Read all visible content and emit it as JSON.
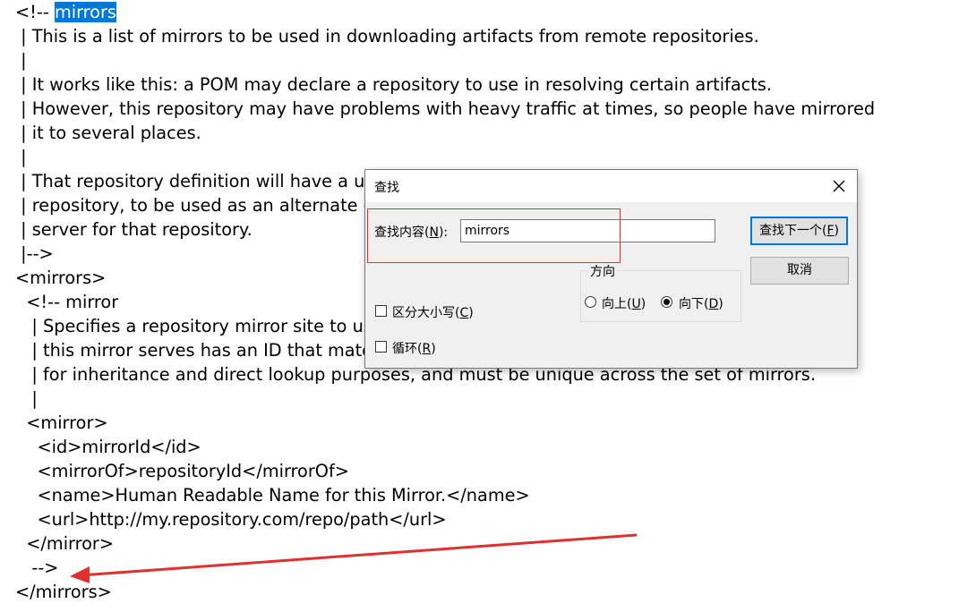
{
  "editor": {
    "lines": [
      {
        "pre": "<!-- ",
        "hl": "mirrors",
        "post": ""
      },
      {
        "pre": " | This is a list of mirrors to be used in downloading artifacts from remote repositories.",
        "hl": "",
        "post": ""
      },
      {
        "pre": " |",
        "hl": "",
        "post": ""
      },
      {
        "pre": " | It works like this: a POM may declare a repository to use in resolving certain artifacts.",
        "hl": "",
        "post": ""
      },
      {
        "pre": " | However, this repository may have problems with heavy traffic at times, so people have mirrored",
        "hl": "",
        "post": ""
      },
      {
        "pre": " | it to several places.",
        "hl": "",
        "post": ""
      },
      {
        "pre": " |",
        "hl": "",
        "post": ""
      },
      {
        "pre": " | That repository definition will have a unique id, so we can create a mirror reference for that",
        "hl": "",
        "post": ""
      },
      {
        "pre": " | repository, to be used as an alternate download site. The mirror site will be the preferred",
        "hl": "",
        "post": ""
      },
      {
        "pre": " | server for that repository.",
        "hl": "",
        "post": ""
      },
      {
        "pre": " |-->",
        "hl": "",
        "post": ""
      },
      {
        "pre": "<mirrors>",
        "hl": "",
        "post": ""
      },
      {
        "pre": "  <!-- mirror",
        "hl": "",
        "post": ""
      },
      {
        "pre": "   | Specifies a repository mirror site to use instead of a given repository. The repository that",
        "hl": "",
        "post": ""
      },
      {
        "pre": "   | this mirror serves has an ID that matches the mirrorOf element of this mirror. IDs are used",
        "hl": "",
        "post": ""
      },
      {
        "pre": "   | for inheritance and direct lookup purposes, and must be unique across the set of mirrors.",
        "hl": "",
        "post": ""
      },
      {
        "pre": "   |",
        "hl": "",
        "post": ""
      },
      {
        "pre": "  <mirror>",
        "hl": "",
        "post": ""
      },
      {
        "pre": "    <id>mirrorId</id>",
        "hl": "",
        "post": ""
      },
      {
        "pre": "    <mirrorOf>repositoryId</mirrorOf>",
        "hl": "",
        "post": ""
      },
      {
        "pre": "    <name>Human Readable Name for this Mirror.</name>",
        "hl": "",
        "post": ""
      },
      {
        "pre": "    <url>http://my.repository.com/repo/path</url>",
        "hl": "",
        "post": ""
      },
      {
        "pre": "  </mirror>",
        "hl": "",
        "post": ""
      },
      {
        "pre": "   -->",
        "hl": "",
        "post": ""
      },
      {
        "pre": "</mirrors>",
        "hl": "",
        "post": ""
      }
    ]
  },
  "dialog": {
    "title": "查找",
    "close_icon": "close-icon",
    "find_label": "查找内容(",
    "find_label_key": "N",
    "find_label_end": "):",
    "find_value": "mirrors",
    "find_next_label": "查找下一个(",
    "find_next_key": "F",
    "find_next_end": ")",
    "cancel_label": "取消",
    "direction_label": "方向",
    "up_label": "向上(",
    "up_key": "U",
    "up_end": ")",
    "down_label": "向下(",
    "down_key": "D",
    "down_end": ")",
    "direction_selected": "down",
    "match_case_label": "区分大小写(",
    "match_case_key": "C",
    "match_case_end": ")",
    "match_case_checked": false,
    "wrap_label": "循环(",
    "wrap_key": "R",
    "wrap_end": ")",
    "wrap_checked": false
  },
  "colors": {
    "selection": "#0078d7",
    "annotation": "#e03030",
    "dialog_bg": "#f0f0f0",
    "focus_border": "#0078d7"
  }
}
